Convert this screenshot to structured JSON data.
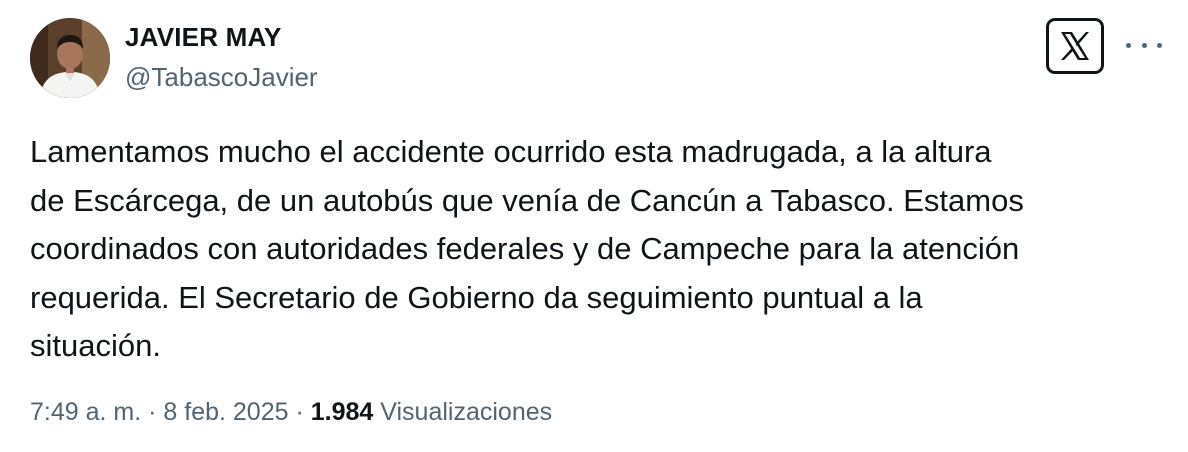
{
  "author": {
    "name": "JAVIER MAY",
    "handle": "@TabascoJavier"
  },
  "header": {
    "logo_icon": "x-logo-icon",
    "more_icon": "more-options-icon"
  },
  "tweet": {
    "text": "Lamentamos mucho el accidente ocurrido esta madrugada, a la altura\nde Escárcega, de un autobús que venía de Cancún a Tabasco. Estamos\ncoordinados con autoridades federales y de Campeche para la atención\nrequerida. El Secretario de Gobierno da seguimiento puntual a la\nsituación."
  },
  "meta": {
    "time": "7:49 a. m.",
    "separator": "·",
    "date": "8 feb. 2025",
    "views_count": "1.984",
    "views_label": "Visualizaciones"
  },
  "colors": {
    "text": "#0f1419",
    "secondary": "#536471",
    "background": "#ffffff"
  }
}
